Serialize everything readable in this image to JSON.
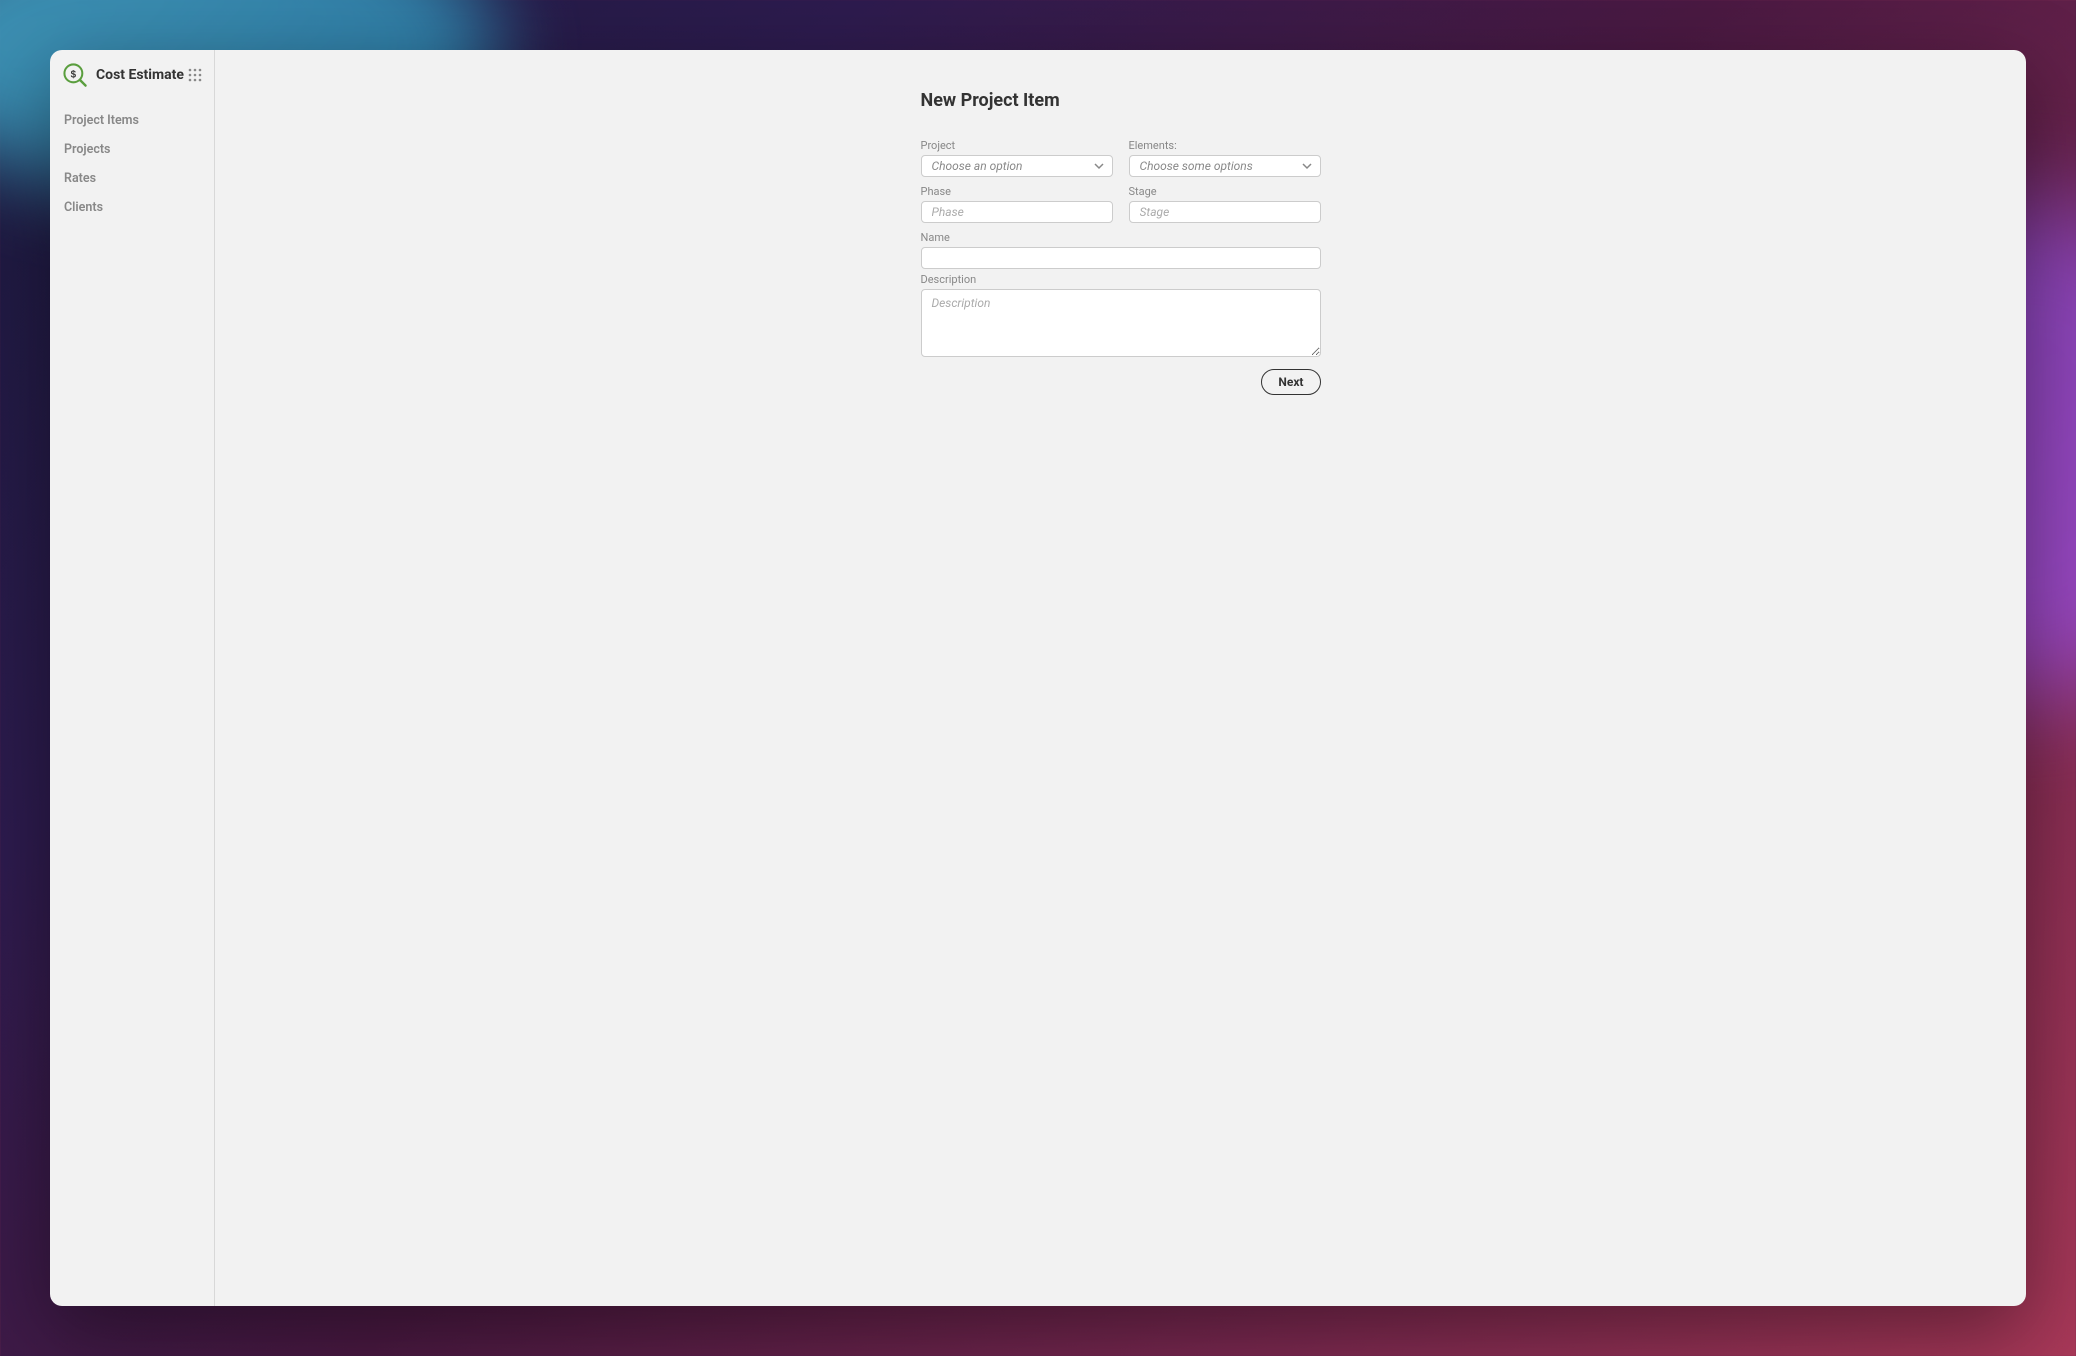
{
  "app": {
    "title": "Cost Estimate"
  },
  "sidebar": {
    "items": [
      {
        "label": "Project Items"
      },
      {
        "label": "Projects"
      },
      {
        "label": "Rates"
      },
      {
        "label": "Clients"
      }
    ]
  },
  "page": {
    "title": "New Project Item"
  },
  "form": {
    "project": {
      "label": "Project",
      "placeholder": "Choose an option"
    },
    "elements": {
      "label": "Elements:",
      "placeholder": "Choose some options"
    },
    "phase": {
      "label": "Phase",
      "placeholder": "Phase"
    },
    "stage": {
      "label": "Stage",
      "placeholder": "Stage"
    },
    "name": {
      "label": "Name",
      "placeholder": ""
    },
    "description": {
      "label": "Description",
      "placeholder": "Description"
    },
    "next_button": "Next"
  }
}
